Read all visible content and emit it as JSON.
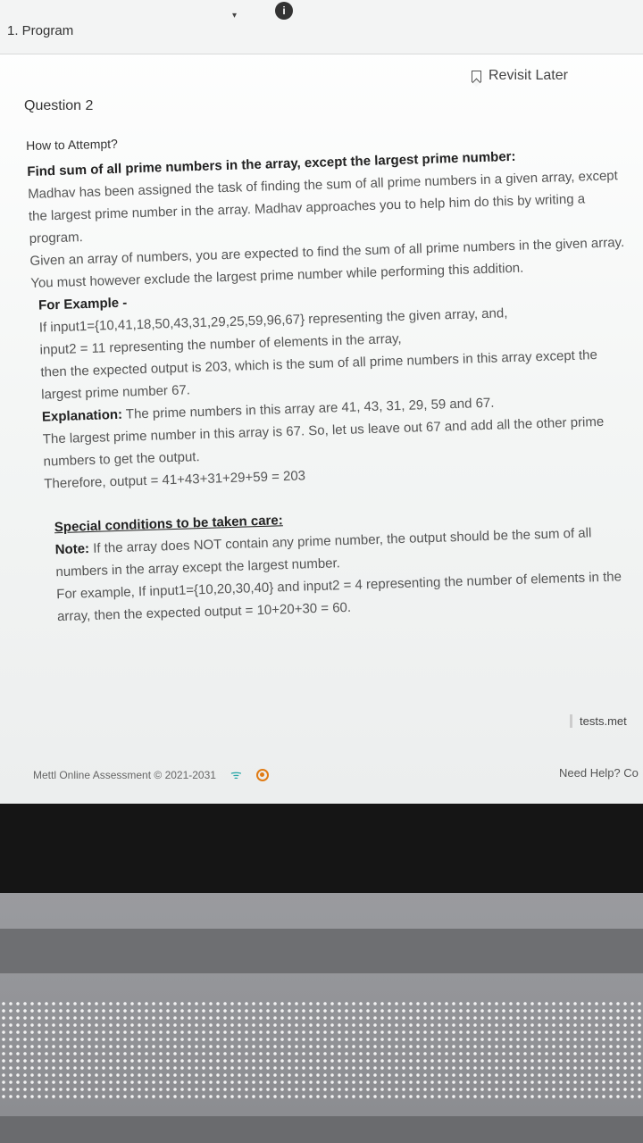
{
  "header": {
    "section": "1. Program",
    "caret": "▾",
    "info": "i"
  },
  "revisit_label": "Revisit Later",
  "question_title": "Question 2",
  "how_to_attempt": "How to Attempt?",
  "problem": {
    "title": "Find sum of all prime numbers in the array, except the largest prime number:",
    "para1": "Madhav has been assigned the task of finding the sum of all prime numbers in a given array, except the largest prime number in the array. Madhav approaches you to help him do this by writing a program.",
    "para2": "Given an array of numbers, you are expected to find the sum of all prime numbers in the given array. You must however exclude the largest prime number while performing this addition.",
    "example_head": "For Example -",
    "example_line1": "If input1={10,41,18,50,43,31,29,25,59,96,67} representing the given array, and,",
    "example_line2": "input2 = 11 representing the number of elements in the array,",
    "example_line3": "then the expected output is 203, which is the sum of all prime numbers in this array except the largest prime number 67.",
    "explanation_label": "Explanation:",
    "explanation_text": " The prime numbers in this array are 41, 43, 31, 29, 59 and 67.",
    "explanation_line2": "The largest prime number in this array is 67. So, let us leave out 67 and add all the other prime numbers to get the output.",
    "therefore": "Therefore, output = 41+43+31+29+59 = 203",
    "special_head": "Special conditions to be taken care:",
    "note_label": "Note:",
    "note_text": " If the array does NOT contain any prime number, the output should be the sum of all numbers in the array except the largest number.",
    "note_example": "For example, If input1={10,20,30,40} and input2 = 4 representing the number of elements in the array, then the expected output = 10+20+30 = 60."
  },
  "footer": {
    "copyright": "Mettl Online Assessment © 2021-2031",
    "wifi": "ᯤ",
    "tests_link": "tests.met",
    "need_help": "Need Help? Co"
  }
}
